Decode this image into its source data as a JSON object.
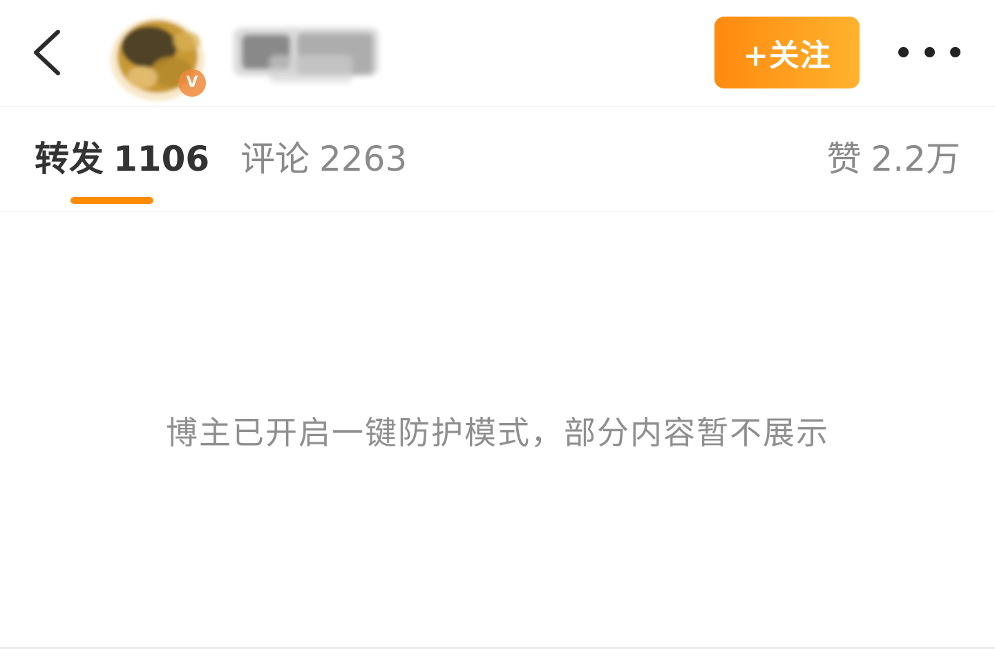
{
  "header": {
    "follow_label": "+关注",
    "icons": {
      "back": "chevron-left-icon",
      "more": "more-horizontal-icon",
      "verified": "verified-v-icon"
    },
    "verified_badge_letter": "V",
    "colors": {
      "follow_gradient_start": "#ff8a0f",
      "follow_gradient_end": "#ffb22e",
      "verified_badge": "#f08a3c"
    }
  },
  "tabs": [
    {
      "label": "转发",
      "count": "1106",
      "active": true
    },
    {
      "label": "评论",
      "count": "2263",
      "active": false
    },
    {
      "label": "赞",
      "count": "2.2万",
      "active": false
    }
  ],
  "tab_indicator_color": "#ff8c00",
  "main": {
    "empty_message": "博主已开启一键防护模式，部分内容暂不展示"
  }
}
